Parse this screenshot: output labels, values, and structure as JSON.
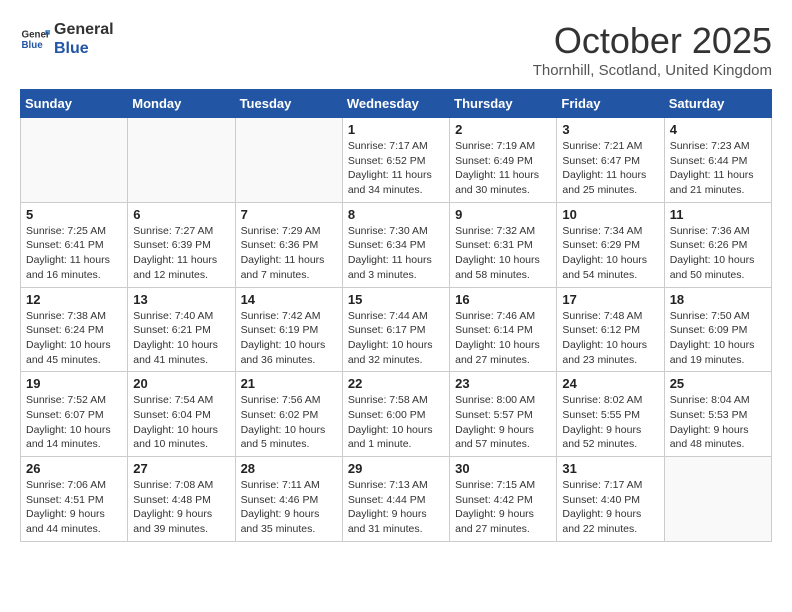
{
  "header": {
    "logo_general": "General",
    "logo_blue": "Blue",
    "month": "October 2025",
    "location": "Thornhill, Scotland, United Kingdom"
  },
  "weekdays": [
    "Sunday",
    "Monday",
    "Tuesday",
    "Wednesday",
    "Thursday",
    "Friday",
    "Saturday"
  ],
  "weeks": [
    [
      {
        "day": "",
        "info": ""
      },
      {
        "day": "",
        "info": ""
      },
      {
        "day": "",
        "info": ""
      },
      {
        "day": "1",
        "info": "Sunrise: 7:17 AM\nSunset: 6:52 PM\nDaylight: 11 hours\nand 34 minutes."
      },
      {
        "day": "2",
        "info": "Sunrise: 7:19 AM\nSunset: 6:49 PM\nDaylight: 11 hours\nand 30 minutes."
      },
      {
        "day": "3",
        "info": "Sunrise: 7:21 AM\nSunset: 6:47 PM\nDaylight: 11 hours\nand 25 minutes."
      },
      {
        "day": "4",
        "info": "Sunrise: 7:23 AM\nSunset: 6:44 PM\nDaylight: 11 hours\nand 21 minutes."
      }
    ],
    [
      {
        "day": "5",
        "info": "Sunrise: 7:25 AM\nSunset: 6:41 PM\nDaylight: 11 hours\nand 16 minutes."
      },
      {
        "day": "6",
        "info": "Sunrise: 7:27 AM\nSunset: 6:39 PM\nDaylight: 11 hours\nand 12 minutes."
      },
      {
        "day": "7",
        "info": "Sunrise: 7:29 AM\nSunset: 6:36 PM\nDaylight: 11 hours\nand 7 minutes."
      },
      {
        "day": "8",
        "info": "Sunrise: 7:30 AM\nSunset: 6:34 PM\nDaylight: 11 hours\nand 3 minutes."
      },
      {
        "day": "9",
        "info": "Sunrise: 7:32 AM\nSunset: 6:31 PM\nDaylight: 10 hours\nand 58 minutes."
      },
      {
        "day": "10",
        "info": "Sunrise: 7:34 AM\nSunset: 6:29 PM\nDaylight: 10 hours\nand 54 minutes."
      },
      {
        "day": "11",
        "info": "Sunrise: 7:36 AM\nSunset: 6:26 PM\nDaylight: 10 hours\nand 50 minutes."
      }
    ],
    [
      {
        "day": "12",
        "info": "Sunrise: 7:38 AM\nSunset: 6:24 PM\nDaylight: 10 hours\nand 45 minutes."
      },
      {
        "day": "13",
        "info": "Sunrise: 7:40 AM\nSunset: 6:21 PM\nDaylight: 10 hours\nand 41 minutes."
      },
      {
        "day": "14",
        "info": "Sunrise: 7:42 AM\nSunset: 6:19 PM\nDaylight: 10 hours\nand 36 minutes."
      },
      {
        "day": "15",
        "info": "Sunrise: 7:44 AM\nSunset: 6:17 PM\nDaylight: 10 hours\nand 32 minutes."
      },
      {
        "day": "16",
        "info": "Sunrise: 7:46 AM\nSunset: 6:14 PM\nDaylight: 10 hours\nand 27 minutes."
      },
      {
        "day": "17",
        "info": "Sunrise: 7:48 AM\nSunset: 6:12 PM\nDaylight: 10 hours\nand 23 minutes."
      },
      {
        "day": "18",
        "info": "Sunrise: 7:50 AM\nSunset: 6:09 PM\nDaylight: 10 hours\nand 19 minutes."
      }
    ],
    [
      {
        "day": "19",
        "info": "Sunrise: 7:52 AM\nSunset: 6:07 PM\nDaylight: 10 hours\nand 14 minutes."
      },
      {
        "day": "20",
        "info": "Sunrise: 7:54 AM\nSunset: 6:04 PM\nDaylight: 10 hours\nand 10 minutes."
      },
      {
        "day": "21",
        "info": "Sunrise: 7:56 AM\nSunset: 6:02 PM\nDaylight: 10 hours\nand 5 minutes."
      },
      {
        "day": "22",
        "info": "Sunrise: 7:58 AM\nSunset: 6:00 PM\nDaylight: 10 hours\nand 1 minute."
      },
      {
        "day": "23",
        "info": "Sunrise: 8:00 AM\nSunset: 5:57 PM\nDaylight: 9 hours\nand 57 minutes."
      },
      {
        "day": "24",
        "info": "Sunrise: 8:02 AM\nSunset: 5:55 PM\nDaylight: 9 hours\nand 52 minutes."
      },
      {
        "day": "25",
        "info": "Sunrise: 8:04 AM\nSunset: 5:53 PM\nDaylight: 9 hours\nand 48 minutes."
      }
    ],
    [
      {
        "day": "26",
        "info": "Sunrise: 7:06 AM\nSunset: 4:51 PM\nDaylight: 9 hours\nand 44 minutes."
      },
      {
        "day": "27",
        "info": "Sunrise: 7:08 AM\nSunset: 4:48 PM\nDaylight: 9 hours\nand 39 minutes."
      },
      {
        "day": "28",
        "info": "Sunrise: 7:11 AM\nSunset: 4:46 PM\nDaylight: 9 hours\nand 35 minutes."
      },
      {
        "day": "29",
        "info": "Sunrise: 7:13 AM\nSunset: 4:44 PM\nDaylight: 9 hours\nand 31 minutes."
      },
      {
        "day": "30",
        "info": "Sunrise: 7:15 AM\nSunset: 4:42 PM\nDaylight: 9 hours\nand 27 minutes."
      },
      {
        "day": "31",
        "info": "Sunrise: 7:17 AM\nSunset: 4:40 PM\nDaylight: 9 hours\nand 22 minutes."
      },
      {
        "day": "",
        "info": ""
      }
    ]
  ]
}
